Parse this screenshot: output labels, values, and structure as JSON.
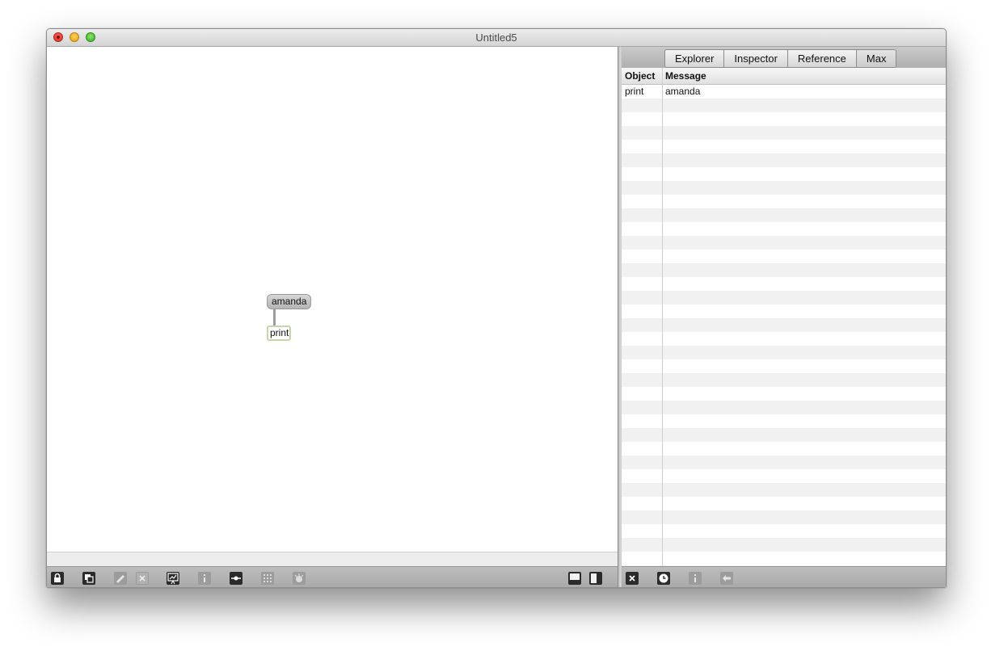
{
  "window": {
    "title": "Untitled5"
  },
  "patcher": {
    "message_box": "amanda",
    "object_box": "print"
  },
  "sidebar": {
    "tabs": [
      "Explorer",
      "Inspector",
      "Reference",
      "Max"
    ],
    "active_tab": "Max",
    "columns": [
      "Object",
      "Message"
    ],
    "rows": [
      {
        "object": "print",
        "message": "amanda"
      }
    ]
  },
  "toolbar": {
    "icons": [
      "lock-icon",
      "copy-icon",
      "edit-icon",
      "delete-icon",
      "presentation-icon",
      "info-icon",
      "patch-cord-icon",
      "grid-icon",
      "snap-icon",
      "bottom-pane-icon",
      "side-pane-icon"
    ]
  },
  "sidebar_toolbar": {
    "icons": [
      "clear-icon",
      "clock-icon",
      "info-icon",
      "back-icon"
    ]
  }
}
